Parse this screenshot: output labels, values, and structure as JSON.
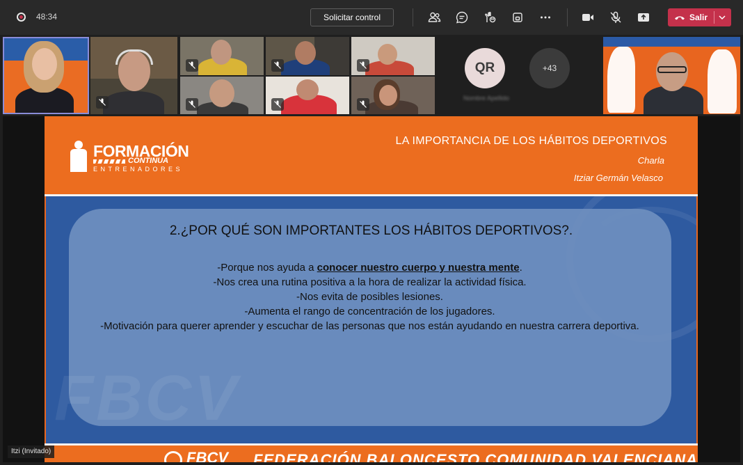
{
  "toolbar": {
    "timer": "48:34",
    "request_control_label": "Solicitar control",
    "leave_label": "Salir",
    "icons": [
      "participants-icon",
      "chat-icon",
      "reactions-icon",
      "rooms-icon",
      "more-icon",
      "camera-icon",
      "mic-muted-icon",
      "share-icon"
    ]
  },
  "participants": {
    "overflow_avatar_initials": "QR",
    "overflow_avatar_name": "Nombre Apellido",
    "more_count": "+43"
  },
  "slide": {
    "logo_text": "FORMACIÓN",
    "logo_sub": "CONTINUA",
    "logo_small": "ENTRENADORES",
    "title": "LA IMPORTANCIA DE LOS HÁBITOS DEPORTIVOS",
    "type": "Charla",
    "author": "Itziar Germán Velasco",
    "question": "2.¿POR QUÉ SON IMPORTANTES LOS HÁBITOS DEPORTIVOS?.",
    "bullet_1_prefix": "-Porque nos ayuda a ",
    "bullet_1_emph": "conocer nuestro cuerpo y nuestra mente",
    "bullet_1_suffix": ".",
    "bullet_2": "-Nos crea una rutina positiva a la hora de realizar la actividad física.",
    "bullet_3": "-Nos evita de posibles lesiones.",
    "bullet_4": "-Aumenta el rango de concentración de los jugadores.",
    "bullet_5": "-Motivación para querer aprender y escuchar de las personas que nos están ayudando en nuestra carrera deportiva.",
    "watermark": "FBCV",
    "footer_logo": "FBCV",
    "footer_text": "FEDERACIÓN BALONCESTO COMUNIDAD VALENCIANA"
  },
  "presenter_name": "Itzi (Invitado)",
  "colors": {
    "toolbar_bg": "#292929",
    "leave_red": "#c4314b",
    "slide_orange": "#ec6d1f",
    "slide_blue": "#2e5aa0",
    "active_speaker_border": "#8a8cd8"
  }
}
